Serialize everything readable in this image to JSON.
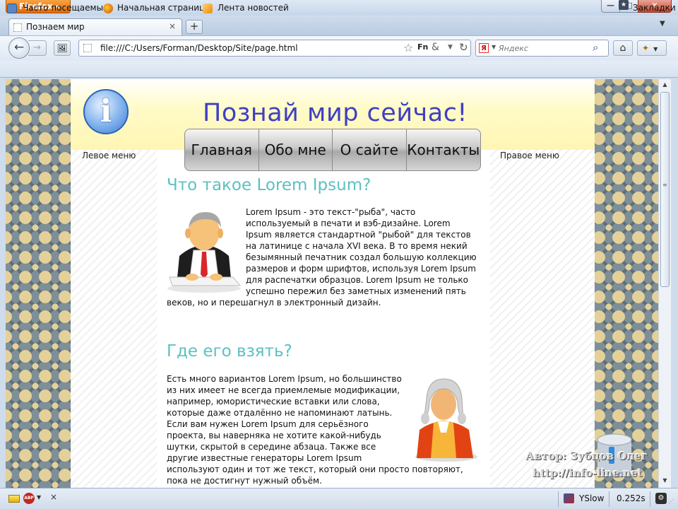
{
  "window": {
    "app_button": "Firefox",
    "min_glyph": "—",
    "max_glyph": "□",
    "close_glyph": "✕"
  },
  "tabs": [
    {
      "title": "Познаем мир",
      "close_glyph": "×",
      "favicon": "blank-page-icon"
    }
  ],
  "new_tab_glyph": "+",
  "tab_list_glyph": "▼",
  "nav": {
    "back_glyph": "←",
    "forward_glyph": "→",
    "url": "file:///C:/Users/Forman/Desktop/Site/page.html",
    "star_glyph": "☆",
    "fn_glyph": "Fn",
    "amp_glyph": "&",
    "drop_glyph": "▼",
    "reload_glyph": "↻",
    "search_engine_glyph": "Я",
    "search_placeholder": "Яндекс",
    "search_go_glyph": "⌕",
    "home_glyph": "⌂",
    "addon_glyph": "✦",
    "addon_drop": "▼"
  },
  "bookmarks": [
    {
      "label": "Часто посещаемые",
      "icon": "smart-folder-icon"
    },
    {
      "label": "Начальная страница",
      "icon": "firefox-icon"
    },
    {
      "label": "Лента новостей",
      "icon": "rss-icon"
    },
    {
      "label": "Закладки",
      "icon": "bookmarks-menu-icon"
    }
  ],
  "bookmarks_menu_glyph": "★",
  "site": {
    "title": "Познай мир сейчас!",
    "logo_glyph": "i",
    "menu": [
      "Главная",
      "Обо мне",
      "О сайте",
      "Контакты"
    ],
    "left_menu": "Левое меню",
    "right_menu": "Правое меню",
    "sections": [
      {
        "heading": "Что такое Lorem Ipsum?",
        "image": "office-worker-illustration",
        "text": "Lorem Ipsum - это текст-\"рыба\", часто используемый в печати и вэб-дизайне. Lorem Ipsum является стандартной \"рыбой\" для текстов на латинице с начала XVI века. В то время некий безымянный печатник создал большую коллекцию размеров и форм шрифтов, используя Lorem Ipsum для распечатки образцов. Lorem Ipsum не только успешно пережил без заметных изменений пять веков, но и перешагнул в электронный дизайн."
      },
      {
        "heading": "Где его взять?",
        "image": "wigged-man-illustration",
        "text": "Есть много вариантов Lorem Ipsum, но большинство из них имеет не всегда приемлемые модификации, например, юмористические вставки или слова, которые даже отдалённо не напоминают латынь. Если вам нужен Lorem Ipsum для серьёзного проекта, вы наверняка не хотите какой-нибудь шутки, скрытой в середине абзаца. Также все другие известные генераторы Lorem Ipsum используют один и тот же текст, который они просто повторяют, пока не достигнут нужный объём."
      }
    ]
  },
  "watermark": {
    "line1": "Автор: Зубцов Олег",
    "line2": "http://info-line.net"
  },
  "scrollbar": {
    "up_glyph": "▲",
    "down_glyph": "▼",
    "grip_glyph": "≡"
  },
  "status": {
    "abp": "ABP",
    "abp_drop": "▼",
    "close_glyph": "×",
    "yslow": "YSlow",
    "load_time": "0.252s",
    "gear_glyph": "⚙",
    "grip_glyph": "⋰"
  }
}
